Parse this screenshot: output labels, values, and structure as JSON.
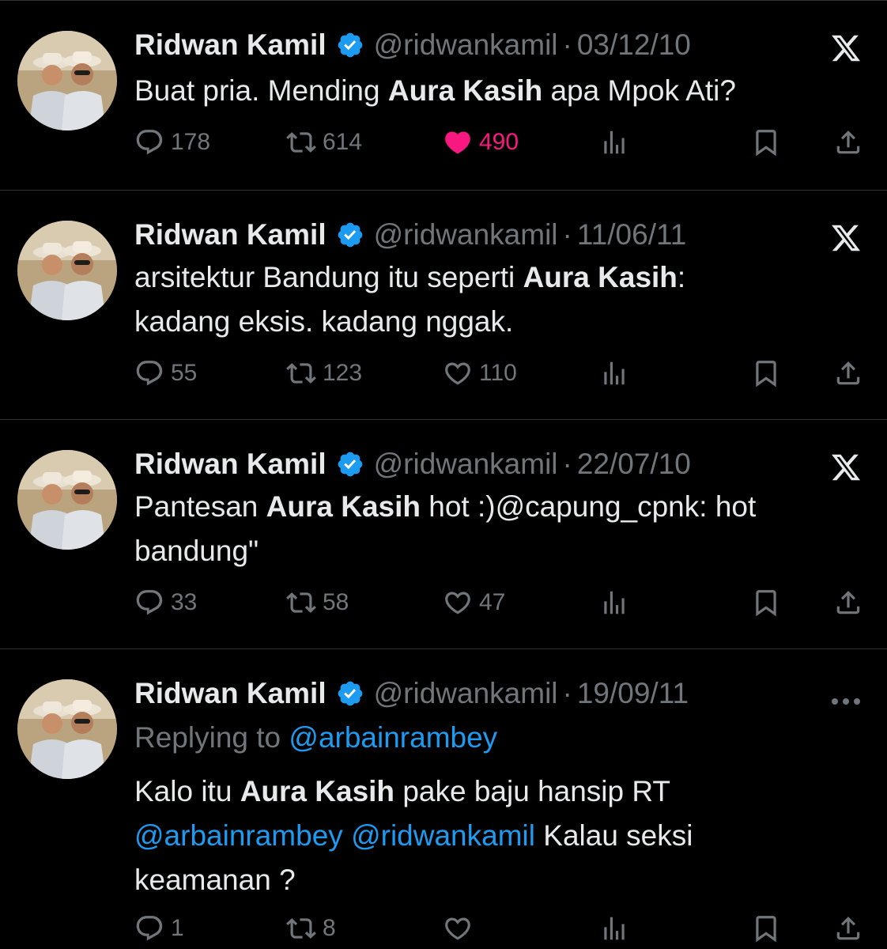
{
  "tweets": [
    {
      "name": "Ridwan Kamil",
      "handle": "@ridwankamil",
      "dot": "·",
      "date": "03/12/10",
      "corner_icon": "x-logo-icon",
      "text_parts": [
        "Buat pria. Mending ",
        "Aura Kasih",
        " apa Mpok Ati?"
      ],
      "replies": "178",
      "reposts": "614",
      "likes": "490",
      "liked": true
    },
    {
      "name": "Ridwan Kamil",
      "handle": "@ridwankamil",
      "dot": "·",
      "date": "11/06/11",
      "corner_icon": "x-logo-icon",
      "text_parts": [
        "arsitektur Bandung itu seperti ",
        "Aura Kasih",
        ":",
        "kadang eksis. kadang nggak."
      ],
      "replies": "55",
      "reposts": "123",
      "likes": "110",
      "liked": false
    },
    {
      "name": "Ridwan Kamil",
      "handle": "@ridwankamil",
      "dot": "·",
      "date": "22/07/10",
      "corner_icon": "x-logo-icon",
      "text_parts": [
        "Pantesan ",
        "Aura Kasih",
        " hot :)@capung_cpnk: hot",
        "bandung\""
      ],
      "replies": "33",
      "reposts": "58",
      "likes": "47",
      "liked": false
    },
    {
      "name": "Ridwan Kamil",
      "handle": "@ridwankamil",
      "dot": "·",
      "date": "19/09/11",
      "corner_icon": "more-icon",
      "replying_label": "Replying to",
      "replying_to": "@arbainrambey",
      "text_parts": [
        "Kalo itu ",
        "Aura Kasih",
        " pake baju hansip RT",
        "@arbainrambey",
        "@ridwankamil",
        " Kalau seksi",
        "keamanan ?"
      ],
      "replies": "1",
      "reposts": "8",
      "likes": "",
      "liked": false
    }
  ],
  "colors": {
    "background": "#000000",
    "text": "#e7e9ea",
    "muted": "#71767b",
    "link": "#1d9bf0",
    "like": "#f91880",
    "divider": "#2f3336",
    "verified": "#1d9bf0"
  }
}
